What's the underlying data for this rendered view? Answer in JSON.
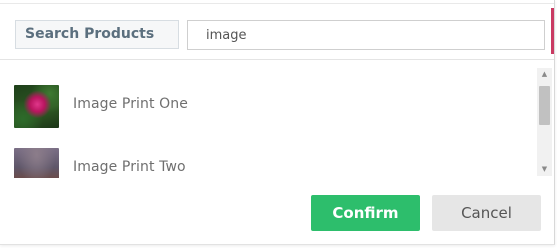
{
  "search": {
    "label": "Search Products",
    "value": "image"
  },
  "results": [
    {
      "name": "Image Print One",
      "thumb_icon": "pink-flower-photo"
    },
    {
      "name": "Image Print Two",
      "thumb_icon": "blurred-landscape-photo"
    }
  ],
  "scrollbar": {
    "up_glyph": "▲",
    "down_glyph": "▼"
  },
  "actions": {
    "confirm_label": "Confirm",
    "cancel_label": "Cancel"
  },
  "colors": {
    "confirm_bg": "#2dbe6c",
    "cancel_bg": "#e6e6e6",
    "label_text": "#5b6f7e",
    "accent": "#c93a62"
  }
}
